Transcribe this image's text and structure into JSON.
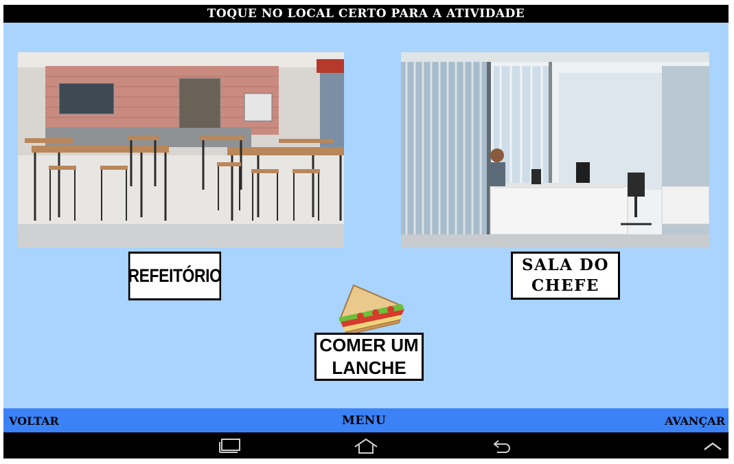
{
  "header": {
    "title": "TOQUE NO LOCAL CERTO PARA A ATIVIDADE"
  },
  "choices": {
    "refeitorio": {
      "label": "REFEITÓRIO",
      "icon": "cafeteria-photo"
    },
    "sala_do_chefe": {
      "label": "SALA DO\nCHEFE",
      "icon": "boss-office-photo"
    }
  },
  "activity": {
    "label": "COMER UM\nLANCHE",
    "icon": "sandwich-icon"
  },
  "nav": {
    "back": "VOLTAR",
    "menu": "MENU",
    "forward": "AVANÇAR"
  },
  "system_bar": {
    "buttons": [
      "recents-icon",
      "home-icon",
      "back-icon",
      "chevron-up-icon"
    ]
  },
  "colors": {
    "stage_bg": "#a9d4fe",
    "nav_bg": "#3b82f6",
    "title_bg": "#000000"
  }
}
